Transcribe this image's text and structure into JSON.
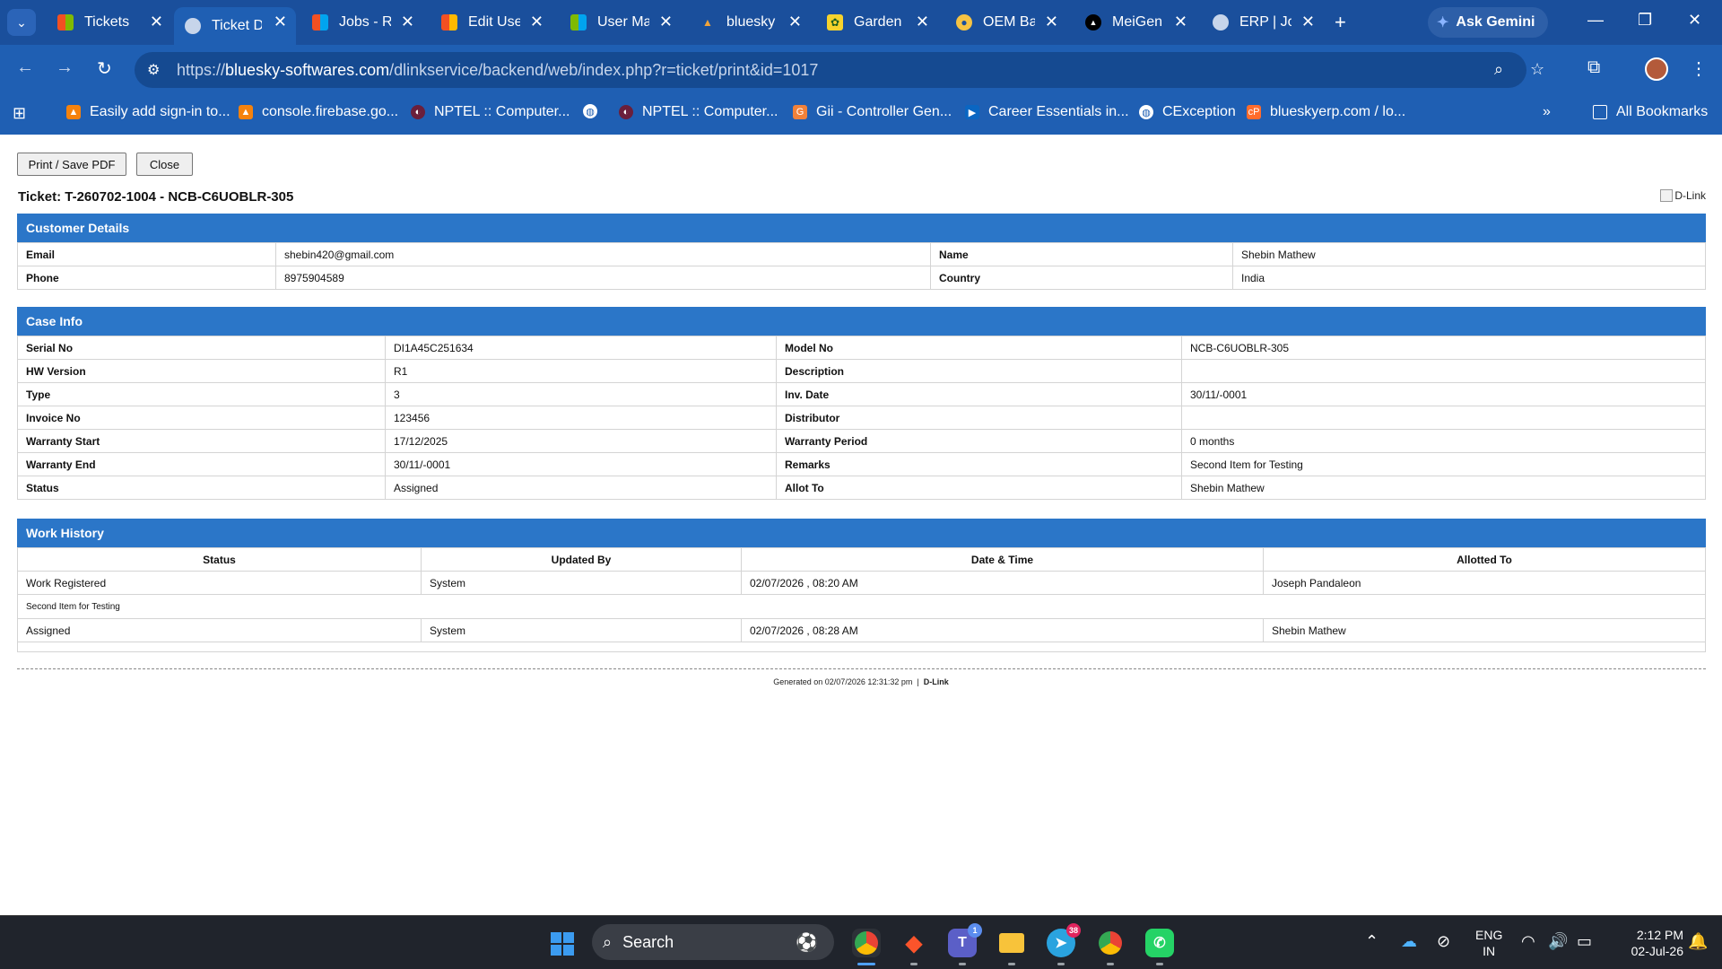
{
  "browser": {
    "tabs": [
      {
        "label": "Tickets",
        "icon": "microsoft-grid-icon",
        "active": false
      },
      {
        "label": "Ticket D",
        "icon": "globe-icon",
        "active": true
      },
      {
        "label": "Jobs - Rl",
        "icon": "microsoft-grid-icon",
        "active": false
      },
      {
        "label": "Edit Use",
        "icon": "microsoft-grid-icon",
        "active": false
      },
      {
        "label": "User Ma",
        "icon": "microsoft-grid-icon",
        "active": false
      },
      {
        "label": "bluesky",
        "icon": "bluesky-logo-icon",
        "active": false
      },
      {
        "label": "Garden",
        "icon": "garden-icon",
        "active": false
      },
      {
        "label": "OEM Ba",
        "icon": "oem-icon",
        "active": false
      },
      {
        "label": "MeiGen",
        "icon": "meigen-icon",
        "active": false
      },
      {
        "label": "ERP | Jo",
        "icon": "globe-icon",
        "active": false
      }
    ],
    "ask_gemini": "Ask Gemini",
    "url_prefix": "https://",
    "url_domain": "bluesky-softwares.com",
    "url_path": "/dlinkservice/backend/web/index.php?r=ticket/print&id=1017",
    "bookmarks": [
      {
        "label": "Easily add sign-in to...",
        "icon": "firebase-icon"
      },
      {
        "label": "console.firebase.go...",
        "icon": "firebase-icon"
      },
      {
        "label": "NPTEL :: Computer...",
        "icon": "nptel-icon"
      },
      {
        "label": "",
        "icon": "globe-icon"
      },
      {
        "label": "NPTEL :: Computer...",
        "icon": "nptel-icon"
      },
      {
        "label": "Gii - Controller Gen...",
        "icon": "gii-icon"
      },
      {
        "label": "Career Essentials in...",
        "icon": "linkedin-learning-icon"
      },
      {
        "label": "CException",
        "icon": "globe-icon"
      },
      {
        "label": "blueskyerp.com / lo...",
        "icon": "cpanel-icon"
      }
    ],
    "all_bookmarks": "All Bookmarks"
  },
  "page": {
    "print_button": "Print / Save PDF",
    "close_button": "Close",
    "ticket_title": "Ticket: T-260702-1004 - NCB-C6UOBLR-305",
    "brand_alt": "D-Link",
    "customer": {
      "heading": "Customer Details",
      "rows": [
        {
          "l1": "Email",
          "v1": "shebin420@gmail.com",
          "l2": "Name",
          "v2": "Shebin Mathew"
        },
        {
          "l1": "Phone",
          "v1": "8975904589",
          "l2": "Country",
          "v2": "India"
        }
      ]
    },
    "case": {
      "heading": "Case Info",
      "rows": [
        {
          "l1": "Serial No",
          "v1": "DI1A45C251634",
          "l2": "Model No",
          "v2": "NCB-C6UOBLR-305"
        },
        {
          "l1": "HW Version",
          "v1": "R1",
          "l2": "Description",
          "v2": ""
        },
        {
          "l1": "Type",
          "v1": "3",
          "l2": "Inv. Date",
          "v2": "30/11/-0001"
        },
        {
          "l1": "Invoice No",
          "v1": "123456",
          "l2": "Distributor",
          "v2": ""
        },
        {
          "l1": "Warranty Start",
          "v1": "17/12/2025",
          "l2": "Warranty Period",
          "v2": "0 months"
        },
        {
          "l1": "Warranty End",
          "v1": "30/11/-0001",
          "l2": "Remarks",
          "v2": "Second Item for Testing"
        },
        {
          "l1": "Status",
          "v1": "Assigned",
          "l2": "Allot To",
          "v2": "Shebin Mathew"
        }
      ]
    },
    "history": {
      "heading": "Work History",
      "columns": [
        "Status",
        "Updated By",
        "Date & Time",
        "Allotted To"
      ],
      "rows": [
        {
          "status": "Work Registered",
          "by": "System",
          "time": "02/07/2026 , 08:20 AM",
          "to": "Joseph Pandaleon",
          "note": "Second Item for Testing"
        },
        {
          "status": "Assigned",
          "by": "System",
          "time": "02/07/2026 , 08:28 AM",
          "to": "Shebin Mathew",
          "note": ""
        }
      ]
    },
    "footer_text": "Generated on 02/07/2026 12:31:32 pm",
    "footer_sep": "|",
    "footer_brand": "D-Link"
  },
  "taskbar": {
    "search_placeholder": "Search",
    "telegram_badge": "38",
    "teams_badge": "1",
    "lang_top": "ENG",
    "lang_bottom": "IN",
    "time": "2:12 PM",
    "date": "02-Jul-26"
  }
}
